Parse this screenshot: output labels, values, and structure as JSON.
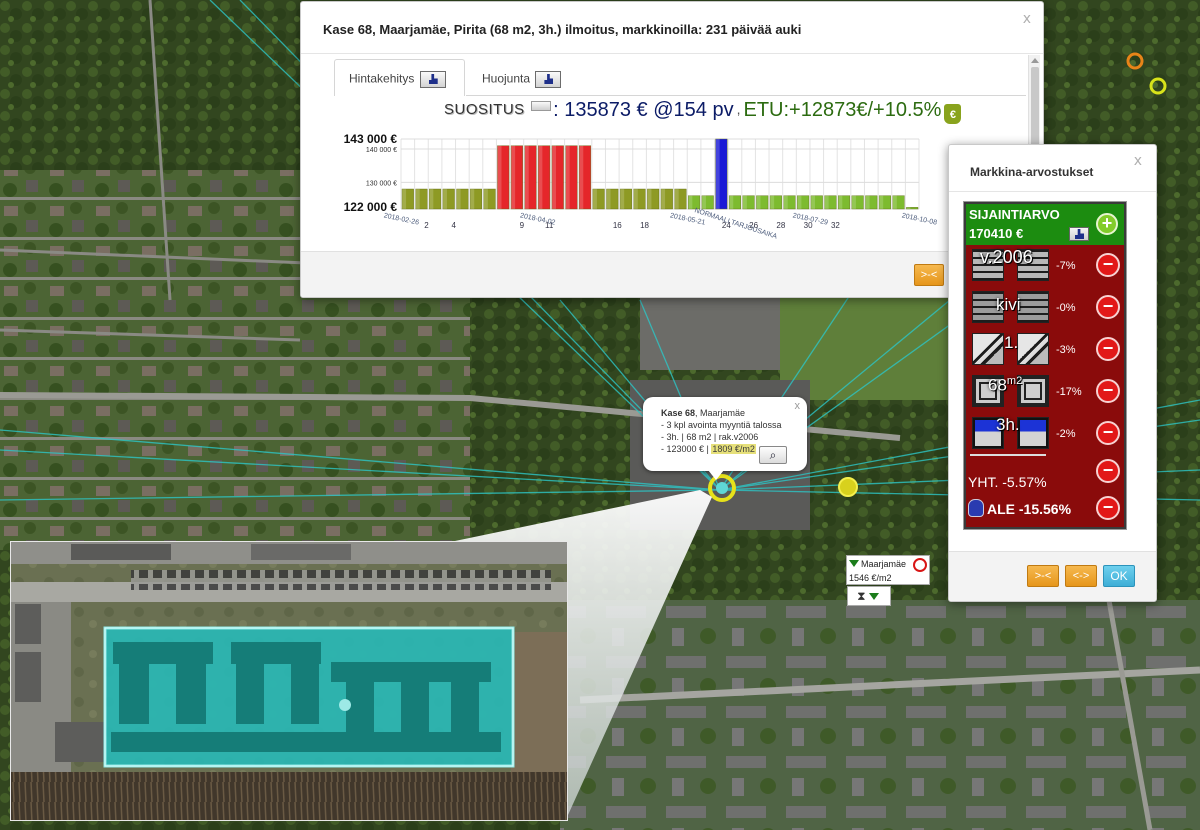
{
  "price_window": {
    "title": "Kase 68, Maarjamäe, Pirita (68 m2, 3h.) ilmoitus, markkinoilla: 231 päivää auki",
    "close": "x",
    "tabs": [
      {
        "label": "Hintakehitys",
        "active": true
      },
      {
        "label": "Huojunta",
        "active": false
      }
    ],
    "recommendation": {
      "label": "SUOSITUS",
      "value": ": 135873 € @154 pv",
      "sep": ",",
      "gain": "ETU:+12873€/+10.5%"
    },
    "footer_button": ">-<"
  },
  "chart_data": {
    "type": "bar",
    "y_major_labels": [
      "143 000 €",
      "122 000 €"
    ],
    "y_minor_labels": [
      "140 000 €",
      "130 000 €"
    ],
    "ylim": [
      122000,
      143000
    ],
    "x_date_labels": [
      "2018-02-26",
      "2018-04-02",
      "2018-05-21",
      "2018-07-29",
      "2018-10-08"
    ],
    "x_number_labels": [
      "2",
      "4",
      "9",
      "11",
      "16",
      "18",
      "24",
      "26",
      "28",
      "30",
      "32"
    ],
    "annotation": "NORMAALI TARJOUSAIKA",
    "bar_colors": {
      "olive": "#8e9a24",
      "red": "#e5262a",
      "green": "#7dbb2f",
      "blue": "#1a1ad6"
    },
    "bars": [
      {
        "value": 128000,
        "color": "olive"
      },
      {
        "value": 128000,
        "color": "olive"
      },
      {
        "value": 128000,
        "color": "olive"
      },
      {
        "value": 128000,
        "color": "olive"
      },
      {
        "value": 128000,
        "color": "olive"
      },
      {
        "value": 128000,
        "color": "olive"
      },
      {
        "value": 128000,
        "color": "olive"
      },
      {
        "value": 141000,
        "color": "red"
      },
      {
        "value": 141000,
        "color": "red"
      },
      {
        "value": 141000,
        "color": "red"
      },
      {
        "value": 141000,
        "color": "red"
      },
      {
        "value": 141000,
        "color": "red"
      },
      {
        "value": 141000,
        "color": "red"
      },
      {
        "value": 141000,
        "color": "red"
      },
      {
        "value": 128000,
        "color": "olive"
      },
      {
        "value": 128000,
        "color": "olive"
      },
      {
        "value": 128000,
        "color": "olive"
      },
      {
        "value": 128000,
        "color": "olive"
      },
      {
        "value": 128000,
        "color": "olive"
      },
      {
        "value": 128000,
        "color": "olive"
      },
      {
        "value": 128000,
        "color": "olive"
      },
      {
        "value": 126000,
        "color": "green"
      },
      {
        "value": 126000,
        "color": "green"
      },
      {
        "value": 143000,
        "color": "blue"
      },
      {
        "value": 126000,
        "color": "green"
      },
      {
        "value": 126000,
        "color": "green"
      },
      {
        "value": 126000,
        "color": "green"
      },
      {
        "value": 126000,
        "color": "green"
      },
      {
        "value": 126000,
        "color": "green"
      },
      {
        "value": 126000,
        "color": "green"
      },
      {
        "value": 126000,
        "color": "green"
      },
      {
        "value": 126000,
        "color": "green"
      },
      {
        "value": 126000,
        "color": "green"
      },
      {
        "value": 126000,
        "color": "green"
      },
      {
        "value": 126000,
        "color": "green"
      },
      {
        "value": 126000,
        "color": "green"
      },
      {
        "value": 126000,
        "color": "green"
      },
      {
        "value": 122500,
        "color": "green"
      }
    ]
  },
  "market_panel": {
    "title": "Markkina-arvostukset",
    "close": "x",
    "location_label": "SIJAINTIARVO",
    "location_value": "170410 €",
    "adjustments": [
      {
        "overlay": "v.2006",
        "pct": "-7%",
        "icon": "brick-wall-icon"
      },
      {
        "overlay": "kivi",
        "pct": "-0%",
        "icon": "stone-wall-icon"
      },
      {
        "overlay": "1.",
        "pct": "-3%",
        "icon": "stairs-icon"
      },
      {
        "overlay": "68",
        "overlay_sup": "m2",
        "pct": "-17%",
        "icon": "floor-plan-icon"
      },
      {
        "overlay": "3h.",
        "pct": "-2%",
        "icon": "rooms-icon"
      }
    ],
    "total": "YHT. -5.57%",
    "discount": "ALE -15.56%",
    "buttons": [
      ">-<",
      "<->",
      "OK"
    ]
  },
  "popup": {
    "title_bold": "Kase 68",
    "title_rest": ", Maarjamäe",
    "lines": [
      "- 3 kpl avointa myyntiä talossa",
      "- 3h. | 68 m2 | rak.v2006"
    ],
    "price_line": "- 123000 € | ",
    "price_per_m2": "1809 €/m2",
    "close": "x",
    "zoom_icon": "⌕"
  },
  "area_label": {
    "name": "Maarjamäe",
    "price": "1546 €/m2",
    "hourglass": "⧗"
  }
}
